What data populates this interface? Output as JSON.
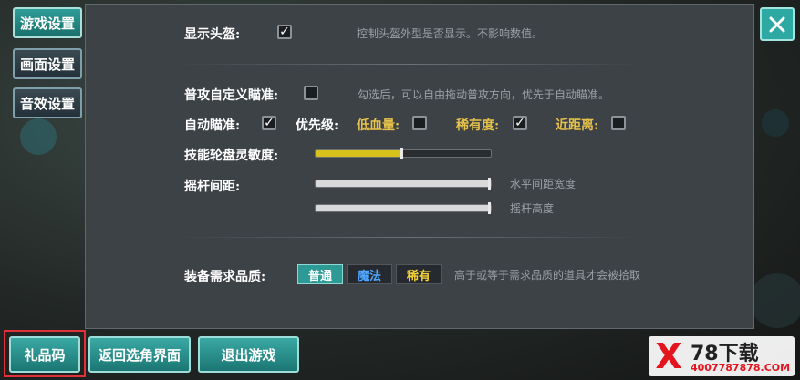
{
  "sidebar": {
    "tabs": [
      {
        "label": "游戏设置"
      },
      {
        "label": "画面设置"
      },
      {
        "label": "音效设置"
      }
    ]
  },
  "settings": {
    "show_helmet": {
      "label": "显示头盔:",
      "checked": true,
      "hint": "控制头盔外型是否显示。不影响数值。"
    },
    "custom_aim": {
      "label": "普攻自定义瞄准:",
      "checked": false,
      "hint": "勾选后，可以自由拖动普攻方向，优先于自动瞄准。"
    },
    "auto_aim": {
      "label": "自动瞄准:",
      "checked": true
    },
    "priority": {
      "label": "优先级:",
      "options": [
        {
          "label": "低血量:",
          "checked": false,
          "color": "#e7c24a"
        },
        {
          "label": "稀有度:",
          "checked": true,
          "color": "#e7c24a"
        },
        {
          "label": "近距离:",
          "checked": false,
          "color": "#e7c24a"
        }
      ]
    },
    "wheel_sensitivity": {
      "label": "技能轮盘灵敏度:",
      "value": 0.5,
      "color": "#d6c21a"
    },
    "joystick": {
      "label": "摇杆间距:",
      "sliders": [
        {
          "hint": "水平间距宽度",
          "value": 1.0
        },
        {
          "hint": "摇杆高度",
          "value": 1.0
        }
      ]
    },
    "equip_quality": {
      "label": "装备需求品质:",
      "options": [
        {
          "label": "普通",
          "selected": true,
          "color": "#ffffff"
        },
        {
          "label": "魔法",
          "selected": false,
          "color": "#4fa6ff"
        },
        {
          "label": "稀有",
          "selected": false,
          "color": "#f2cf3a"
        }
      ],
      "hint": "高于或等于需求品质的道具才会被拾取"
    }
  },
  "bottom": {
    "gift_code": "礼品码",
    "back_to_select": "返回选角界面",
    "exit_game": "退出游戏"
  },
  "watermark": {
    "text": "78下载",
    "url": "4007787878.COM"
  },
  "close_icon": "close-icon"
}
